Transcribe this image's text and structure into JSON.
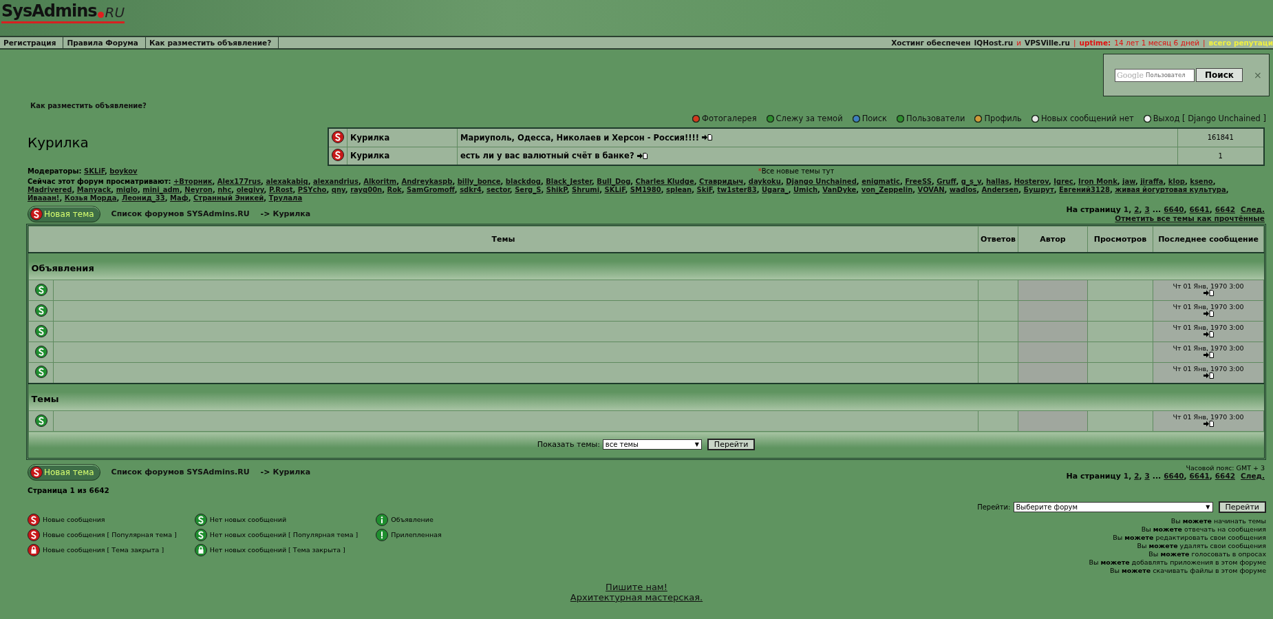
{
  "logo": {
    "main": "SysAdmins",
    "suffix": "RU"
  },
  "nav": [
    "Регистрация",
    "Правила Форума",
    "Как разместить объявление?"
  ],
  "hosting": [
    {
      "kind": "plain",
      "text": "Хостинг обеспечен"
    },
    {
      "kind": "link",
      "text": "IQHost.ru"
    },
    {
      "kind": "red",
      "text": "и"
    },
    {
      "kind": "link",
      "text": "VPSVille.ru"
    },
    {
      "kind": "red",
      "text": "|"
    },
    {
      "kind": "redbold",
      "text": "uptime:"
    },
    {
      "kind": "red",
      "text": "14 лет 1 месяц 6 дней"
    },
    {
      "kind": "red",
      "text": "|"
    },
    {
      "kind": "yellow",
      "text": "всего репутаци"
    }
  ],
  "search": {
    "brand": "Google",
    "placeholder": "Пользовател",
    "button": "Поиск",
    "close": "×"
  },
  "select_caret": "▼",
  "announce_link": "Как разместить объявление?",
  "menu": [
    {
      "label": "Фотогалерея",
      "color": "#d23a1e"
    },
    {
      "label": "Слежу за темой",
      "color": "#2e8f2e"
    },
    {
      "label": "Поиск",
      "color": "#3f7fc0"
    },
    {
      "label": "Пользователи",
      "color": "#2e8f2e"
    },
    {
      "label": "Профиль",
      "color": "#d09a3a"
    },
    {
      "label": "Новых сообщений нет",
      "color": "#e8e8e8"
    },
    {
      "label": "Выход [ Django Unchained ]",
      "color": "#f0f0f0"
    }
  ],
  "forum_title": "Курилка",
  "featured": [
    {
      "kind": "new",
      "forum": "Курилка",
      "topic": "Мариуполь, Одесса, Николаев и Херсон - Россия!!!!",
      "count": "161841"
    },
    {
      "kind": "new",
      "forum": "Курилка",
      "topic": "есть ли у вас валютный счёт в банке?",
      "count": "1"
    }
  ],
  "all_new": {
    "mark": "*",
    "text": "Все новые темы тут"
  },
  "moderators": {
    "label": "Модераторы:",
    "separator": ",",
    "names": [
      "SKLiF",
      "boykov"
    ]
  },
  "viewers": {
    "label": "Сейчас этот форум просматривают:",
    "separator": ",",
    "names": [
      "+Вторник",
      "Alex177rus",
      "alexakabiq",
      "alexandrius",
      "Alkoritm",
      "Andreykaspb",
      "billy_bonce",
      "blackdog",
      "Black_Jester",
      "Bull_Dog",
      "Charles Kludge",
      "Ставридыч",
      "daykoku",
      "Django Unchained",
      "enigmatic",
      "FreeSS",
      "Gruff",
      "g_s_v",
      "hallas",
      "Hosterov",
      "Igrec",
      "Iron Monk",
      "jaw",
      "jiraffa",
      "klop",
      "kseno",
      "Madrivered",
      "Manyack",
      "miglo",
      "mini_adm",
      "Neyron",
      "nhc",
      "olegivy",
      "P.Rost",
      "PSYcho",
      "qny",
      "rayq00n",
      "Rok",
      "SamGromoff",
      "sdkr4",
      "sector",
      "Serg_S",
      "ShikP",
      "Shrumi",
      "SKLiF",
      "SM1980",
      "splean",
      "SkiF",
      "tw1ster83",
      "Ugara_",
      "Umich",
      "VanDyke",
      "von_Zeppelin",
      "VOVAN",
      "wadlos",
      "Andersen",
      "Бушрут",
      "Евгений3128",
      "живая йогуртовая культура",
      "Ивааан!",
      "Козья Морда",
      "Леонид_33",
      "Маф",
      "Странный Эникей",
      "Трулала"
    ]
  },
  "top_bar": {
    "new_topic": "Новая тема",
    "home": "Список форумов SYSAdmins.RU",
    "arrow": "->",
    "current": "Курилка",
    "pagination": {
      "label": "На страницу",
      "pages": [
        {
          "kind": "page",
          "text": "1",
          "selected": true,
          "sep": ","
        },
        {
          "kind": "page",
          "text": "2",
          "selected": false,
          "sep": ","
        },
        {
          "kind": "page",
          "text": "3",
          "selected": false
        },
        {
          "kind": "gap",
          "text": "..."
        },
        {
          "kind": "page",
          "text": "6640",
          "selected": false,
          "sep": ","
        },
        {
          "kind": "page",
          "text": "6641",
          "selected": false,
          "sep": ","
        },
        {
          "kind": "page",
          "text": "6642",
          "selected": false
        }
      ],
      "next": "След."
    },
    "mark_all": "Отметить все темы как прочтённые"
  },
  "table": {
    "columns": [
      "Темы",
      "Ответов",
      "Автор",
      "Просмотров",
      "Последнее сообщение"
    ],
    "sections": [
      {
        "title": "Объявления",
        "rows": [
          {
            "kind": "none",
            "last": "Чт 01 Янв, 1970 3:00"
          },
          {
            "kind": "none",
            "last": "Чт 01 Янв, 1970 3:00"
          },
          {
            "kind": "none",
            "last": "Чт 01 Янв, 1970 3:00"
          },
          {
            "kind": "none",
            "last": "Чт 01 Янв, 1970 3:00"
          },
          {
            "kind": "none",
            "last": "Чт 01 Янв, 1970 3:00"
          }
        ]
      },
      {
        "title": "Темы",
        "rows": [
          {
            "kind": "none",
            "last": "Чт 01 Янв, 1970 3:00"
          }
        ]
      }
    ],
    "filter": {
      "label": "Показать темы:",
      "value": "все темы",
      "button": "Перейти"
    }
  },
  "bottom_bar": {
    "new_topic": "Новая тема",
    "home": "Список форумов SYSAdmins.RU",
    "arrow": "->",
    "current": "Курилка",
    "timezone": "Часовой пояс: GMT + 3",
    "pagination": {
      "label": "На страницу",
      "pages": [
        {
          "kind": "page",
          "text": "1",
          "selected": true,
          "sep": ","
        },
        {
          "kind": "page",
          "text": "2",
          "selected": false,
          "sep": ","
        },
        {
          "kind": "page",
          "text": "3",
          "selected": false
        },
        {
          "kind": "gap",
          "text": "..."
        },
        {
          "kind": "page",
          "text": "6640",
          "selected": false,
          "sep": ","
        },
        {
          "kind": "page",
          "text": "6641",
          "selected": false,
          "sep": ","
        },
        {
          "kind": "page",
          "text": "6642",
          "selected": false
        }
      ],
      "next": "След."
    },
    "page_count": "Страница 1 из 6642"
  },
  "jump": {
    "label": "Перейти:",
    "value": "Выберите форум",
    "button": "Перейти"
  },
  "legend": [
    [
      {
        "kind": "new",
        "text": "Новые сообщения"
      },
      {
        "kind": "new",
        "text": "Новые сообщения [ Популярная тема ]"
      },
      {
        "kind": "new-locked",
        "text": "Новые сообщения [ Тема закрыта ]"
      }
    ],
    [
      {
        "kind": "none",
        "text": "Нет новых сообщений"
      },
      {
        "kind": "none",
        "text": "Нет новых сообщений [ Популярная тема ]"
      },
      {
        "kind": "none-locked",
        "text": "Нет новых сообщений [ Тема закрыта ]"
      }
    ],
    [
      {
        "kind": "announce",
        "text": "Объявление"
      },
      {
        "kind": "sticky",
        "text": "Прилепленная"
      }
    ]
  ],
  "permissions": [
    "Вы **можете** начинать темы",
    "Вы **можете** отвечать на сообщения",
    "Вы **можете** редактировать свои сообщения",
    "Вы **можете** удалять свои сообщения",
    "Вы **можете** голосовать в опросах",
    "Вы **можете** добавлять приложения в этом форуме",
    "Вы **можете** скачивать файлы в этом форуме"
  ],
  "footer": [
    "Пишите нам!",
    "Архитектурная мастерская."
  ]
}
